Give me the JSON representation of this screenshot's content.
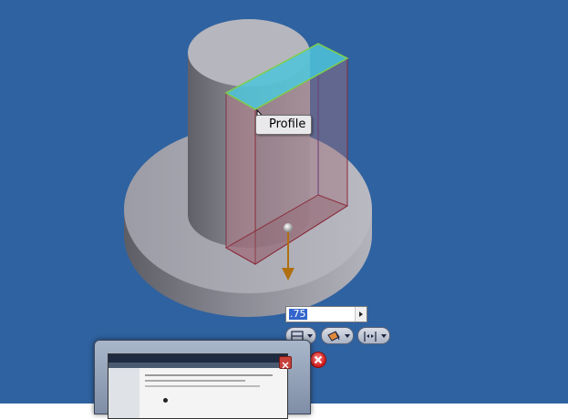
{
  "viewport": {
    "background_color": "#2f62a0",
    "model_color": "#8a8a94"
  },
  "tooltip": {
    "label": "Profile"
  },
  "extrude": {
    "distance_value": ".75"
  },
  "minitoolbar": {
    "icons": [
      "extents-icon",
      "output-icon",
      "direction-icon",
      "cancel-icon"
    ]
  }
}
